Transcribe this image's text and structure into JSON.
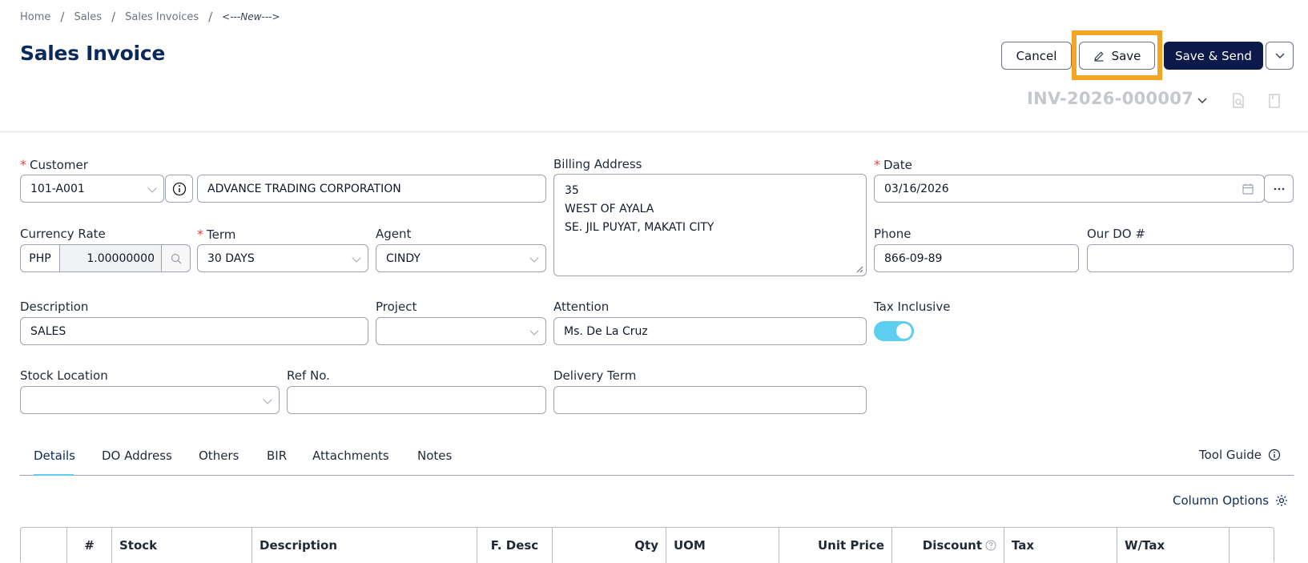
{
  "breadcrumb": {
    "items": [
      "Home",
      "Sales",
      "Sales Invoices"
    ],
    "current": "<---New--->"
  },
  "page_title": "Sales Invoice",
  "actions": {
    "cancel": "Cancel",
    "save": "Save",
    "save_send": "Save & Send"
  },
  "invoice_number": "INV-2026-000007",
  "form": {
    "customer": {
      "label": "Customer",
      "code": "101-A001",
      "name": "ADVANCE TRADING CORPORATION"
    },
    "billing_address": {
      "label": "Billing Address",
      "lines": [
        "35",
        "WEST OF AYALA",
        "SE. JIL PUYAT, MAKATI CITY"
      ]
    },
    "date": {
      "label": "Date",
      "value": "03/16/2026"
    },
    "currency_rate": {
      "label": "Currency Rate",
      "currency": "PHP",
      "rate": "1.00000000"
    },
    "term": {
      "label": "Term",
      "value": "30 DAYS"
    },
    "agent": {
      "label": "Agent",
      "value": "CINDY"
    },
    "phone": {
      "label": "Phone",
      "value": "866-09-89"
    },
    "our_do": {
      "label": "Our DO #",
      "value": ""
    },
    "description": {
      "label": "Description",
      "value": "SALES"
    },
    "project": {
      "label": "Project",
      "value": ""
    },
    "attention": {
      "label": "Attention",
      "value": "Ms. De La Cruz"
    },
    "tax_inclusive": {
      "label": "Tax Inclusive",
      "enabled": true
    },
    "stock_location": {
      "label": "Stock Location",
      "value": ""
    },
    "ref_no": {
      "label": "Ref No.",
      "value": ""
    },
    "delivery_term": {
      "label": "Delivery Term",
      "value": ""
    }
  },
  "tabs": [
    "Details",
    "DO Address",
    "Others",
    "BIR",
    "Attachments",
    "Notes"
  ],
  "active_tab": "Details",
  "tool_guide": "Tool Guide",
  "column_options": "Column Options",
  "table": {
    "columns": [
      "#",
      "Stock",
      "Description",
      "F. Desc",
      "Qty",
      "UOM",
      "Unit Price",
      "Discount",
      "Tax",
      "W/Tax"
    ]
  },
  "colors": {
    "title": "#0b2a5c",
    "primary_button": "#0b1a4a",
    "accent": "#5ccff0",
    "highlight": "#f5a524",
    "required": "#e53e3e"
  }
}
